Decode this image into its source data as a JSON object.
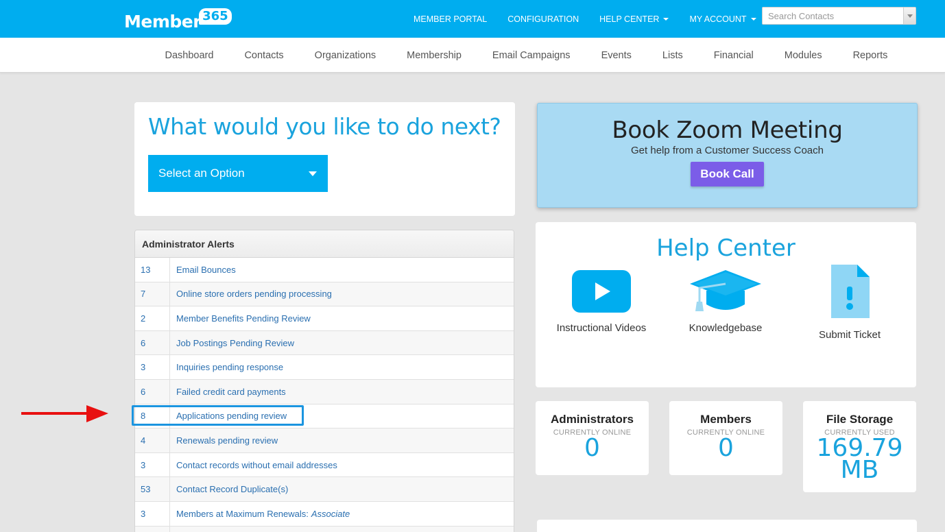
{
  "brand": {
    "name": "Member",
    "badge": "365"
  },
  "topnav": {
    "items": [
      {
        "label": "MEMBER PORTAL",
        "dropdown": false
      },
      {
        "label": "CONFIGURATION",
        "dropdown": false
      },
      {
        "label": "HELP CENTER",
        "dropdown": true
      },
      {
        "label": "MY ACCOUNT",
        "dropdown": true
      }
    ],
    "search_placeholder": "Search Contacts"
  },
  "subnav": [
    "Dashboard",
    "Contacts",
    "Organizations",
    "Membership",
    "Email Campaigns",
    "Events",
    "Lists",
    "Financial",
    "Modules",
    "Reports"
  ],
  "next": {
    "title": "What would you like to do next?",
    "select_label": "Select an Option"
  },
  "alerts": {
    "heading": "Administrator Alerts",
    "rows": [
      {
        "count": "13",
        "label": "Email Bounces",
        "suffix": ""
      },
      {
        "count": "7",
        "label": "Online store orders pending processing",
        "suffix": ""
      },
      {
        "count": "2",
        "label": "Member Benefits Pending Review",
        "suffix": ""
      },
      {
        "count": "6",
        "label": "Job Postings Pending Review",
        "suffix": ""
      },
      {
        "count": "3",
        "label": "Inquiries pending response",
        "suffix": ""
      },
      {
        "count": "6",
        "label": "Failed credit card payments",
        "suffix": ""
      },
      {
        "count": "8",
        "label": "Applications pending review",
        "suffix": ""
      },
      {
        "count": "4",
        "label": "Renewals pending review",
        "suffix": ""
      },
      {
        "count": "3",
        "label": "Contact records without email addresses",
        "suffix": ""
      },
      {
        "count": "53",
        "label": "Contact Record Duplicate(s)",
        "suffix": ""
      },
      {
        "count": "3",
        "label": "Members at Maximum Renewals:",
        "suffix": "Associate"
      },
      {
        "count": "",
        "label": "",
        "suffix": ""
      }
    ]
  },
  "zoom": {
    "title": "Book Zoom Meeting",
    "subtitle": "Get help from a Customer Success Coach",
    "button": "Book Call"
  },
  "help": {
    "title": "Help Center",
    "items": [
      {
        "label": "Instructional Videos",
        "icon": "video-play-icon"
      },
      {
        "label": "Knowledgebase",
        "icon": "graduation-cap-icon"
      },
      {
        "label": "Submit Ticket",
        "icon": "ticket-document-icon"
      }
    ]
  },
  "stats": [
    {
      "title": "Administrators",
      "sub": "CURRENTLY ONLINE",
      "value": "0",
      "unit": ""
    },
    {
      "title": "Members",
      "sub": "CURRENTLY ONLINE",
      "value": "0",
      "unit": ""
    },
    {
      "title": "File Storage",
      "sub": "CURRENTLY USED",
      "value": "169.79",
      "unit": "MB"
    }
  ],
  "colors": {
    "brand": "#00adef",
    "accent": "#1aa3dd",
    "zoom_bg": "#a9daf3",
    "book_button": "#7b5de8",
    "highlight": "#1b95e0",
    "arrow": "#e81010"
  }
}
